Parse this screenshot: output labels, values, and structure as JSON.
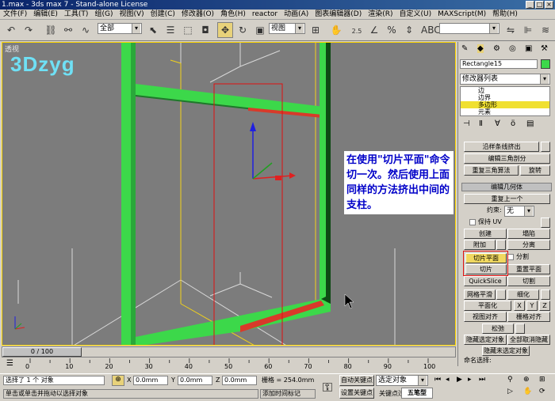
{
  "window": {
    "title": "1.max - 3ds max 7 - Stand-alone License",
    "minimize": "_",
    "maximize": "□",
    "close": "×"
  },
  "menu": [
    "文件(F)",
    "编辑(E)",
    "工具(T)",
    "组(G)",
    "视图(V)",
    "创建(C)",
    "修改器(O)",
    "角色(H)",
    "reactor",
    "动画(A)",
    "图表编辑器(D)",
    "渲染(R)",
    "自定义(U)",
    "MAXScript(M)",
    "帮助(H)"
  ],
  "toolbar": {
    "selection_filter": "全部",
    "ref_coord": "视图",
    "snap_value": "2.5",
    "named_selection": ""
  },
  "viewport": {
    "label": "透视",
    "logo_text": "3Dzyg",
    "annotation": "在使用\"切片平面\"命令切一次。然后使用上面同样的方法挤出中间的支柱。"
  },
  "command_panel": {
    "object_name": "Rectangle15",
    "object_color": "#3cd84a",
    "modifier_list": "修改器列表",
    "stack": [
      "边",
      "边界",
      "多边形",
      "元素"
    ],
    "stack_selected": "多边形",
    "buttons": {
      "extrude_along_spline": "沿样条线挤出",
      "edit_triangulation": "编辑三角剖分",
      "retriangulate": "重复三角算法",
      "turn": "旋转",
      "edit_geometry": "编辑几何体",
      "repeat_last": "重复上一个",
      "constraints_label": "约束:",
      "constraints_value": "无",
      "preserve_uv": "保持 UV",
      "create": "创建",
      "collapse": "塌陷",
      "attach": "附加",
      "detach": "分离",
      "slice_plane": "切片平面",
      "split": "分割",
      "slice": "切片",
      "reset_plane": "重置平面",
      "quickslice": "QuickSlice",
      "cut": "切割",
      "meshsmooth": "网格平滑",
      "tessellate": "细化",
      "planarize": "平面化",
      "x": "X",
      "y": "Y",
      "z": "Z",
      "view_align": "视图对齐",
      "grid_align": "栅格对齐",
      "relax": "松弛",
      "hide_selected": "隐藏选定对象",
      "unhide_all": "全部取消隐藏",
      "hide_unselected": "隐藏未选定对象",
      "named_selections": "命名选择:"
    }
  },
  "timeline": {
    "frame_display": "0 / 100",
    "ticks": [
      "0",
      "10",
      "20",
      "30",
      "40",
      "50",
      "60",
      "70",
      "80",
      "90",
      "100"
    ]
  },
  "status": {
    "selection": "选择了 1 个 对象",
    "prompt": "单击或单击并拖动以选择对象",
    "x_label": "X",
    "x_value": "0.0mm",
    "y_label": "Y",
    "y_value": "0.0mm",
    "z_label": "Z",
    "z_value": "0.0mm",
    "grid": "栅格 = 254.0mm",
    "add_time_tag": "添加时间标记",
    "auto_key": "自动关键点",
    "set_key": "设置关键点",
    "selected_dropdown": "选定对象",
    "key_filters": "关键点过滤器...",
    "wubi": "五笔型"
  }
}
